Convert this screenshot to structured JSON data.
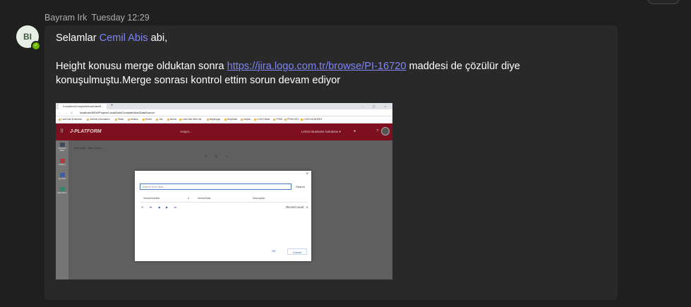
{
  "message": {
    "author": "Bayram Irk",
    "timestamp": "Tuesday 12:29",
    "avatar_initials": "BI",
    "presence_glyph": "✓",
    "greeting_prefix": "Selamlar ",
    "mention": "Cemil Abis",
    "greeting_suffix": " abi,",
    "body_before_link": "Height konusu merge olduktan sonra ",
    "link_text": "https://jira.logo.com.tr/browse/PI-16720",
    "body_after_link": " maddesi de çözülür diye konuşulmuştu.Merge sonrası kontrol ettim sorun devam ediyor"
  },
  "screenshot": {
    "browser_tab": "LocalAutoCompleteAutoDataS...",
    "tab_close": "×",
    "new_tab": "+",
    "window_controls": "–  ▢  ×",
    "nav_glyphs": "← → C",
    "url": "localhost:5000/Project/Local/AutoCompleteAutoDataSource",
    "bookmarks": [
      "LiveCode Extension",
      "Jenkins Information",
      "Slack",
      "Jenkins",
      "Senior",
      "Jira",
      "Nexus",
      "LiveCode Web Ide",
      "Neyaluygo",
      "HelpDesk",
      "Helpim",
      "LOGO Build",
      "PRAS",
      "PRAS DEV",
      "LOGO ACADEMY"
    ],
    "app": {
      "grid_glyph": "⠿",
      "logo": "J-PLATFORM",
      "search_placeholder": "Arayın...",
      "company": "LOGO Business Solutions ▾",
      "icons": "● ? ",
      "side_items": [
        "Resource Editor",
        "Platform",
        "App Flow",
        "Model Flow"
      ],
      "breadcrumb": "Ana Sayfa · Data Source",
      "toolbar_glyphs": "+ ✎ ⌕"
    },
    "dialog": {
      "close": "×",
      "search_placeholder": "Search from lists...",
      "search_button": "Search",
      "columns": [
        "VendorNumber",
        "#",
        "VendorDate",
        "Description"
      ],
      "pager": "⟳ ⏮ ◀ ▶ ⏭",
      "record_count": "Record count : 4",
      "ok": "OK",
      "cancel": "Cancel"
    }
  }
}
